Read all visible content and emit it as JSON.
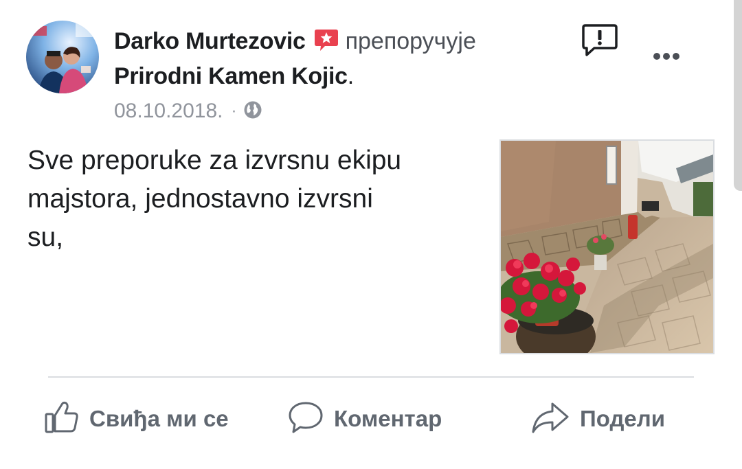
{
  "post": {
    "author": "Darko Murtezovic",
    "recommends_word": "препоручује",
    "page_name": "Prirodni Kamen Kojic",
    "period": ".",
    "date": "08.10.2018.",
    "separator": "·",
    "privacy_icon": "globe-icon",
    "body_lines": [
      "Sve preporuke za izvrsnu ekipu",
      "majstora, jednostavno izvrsni",
      "su,"
    ]
  },
  "actions": {
    "like_label": "Свиђа ми се",
    "comment_label": "Коментар",
    "share_label": "Подели"
  },
  "colors": {
    "text": "#1c1e21",
    "secondary": "#90949c",
    "action_gray": "#606770",
    "recommend_red": "#e9414f",
    "divider": "#dadde1"
  }
}
